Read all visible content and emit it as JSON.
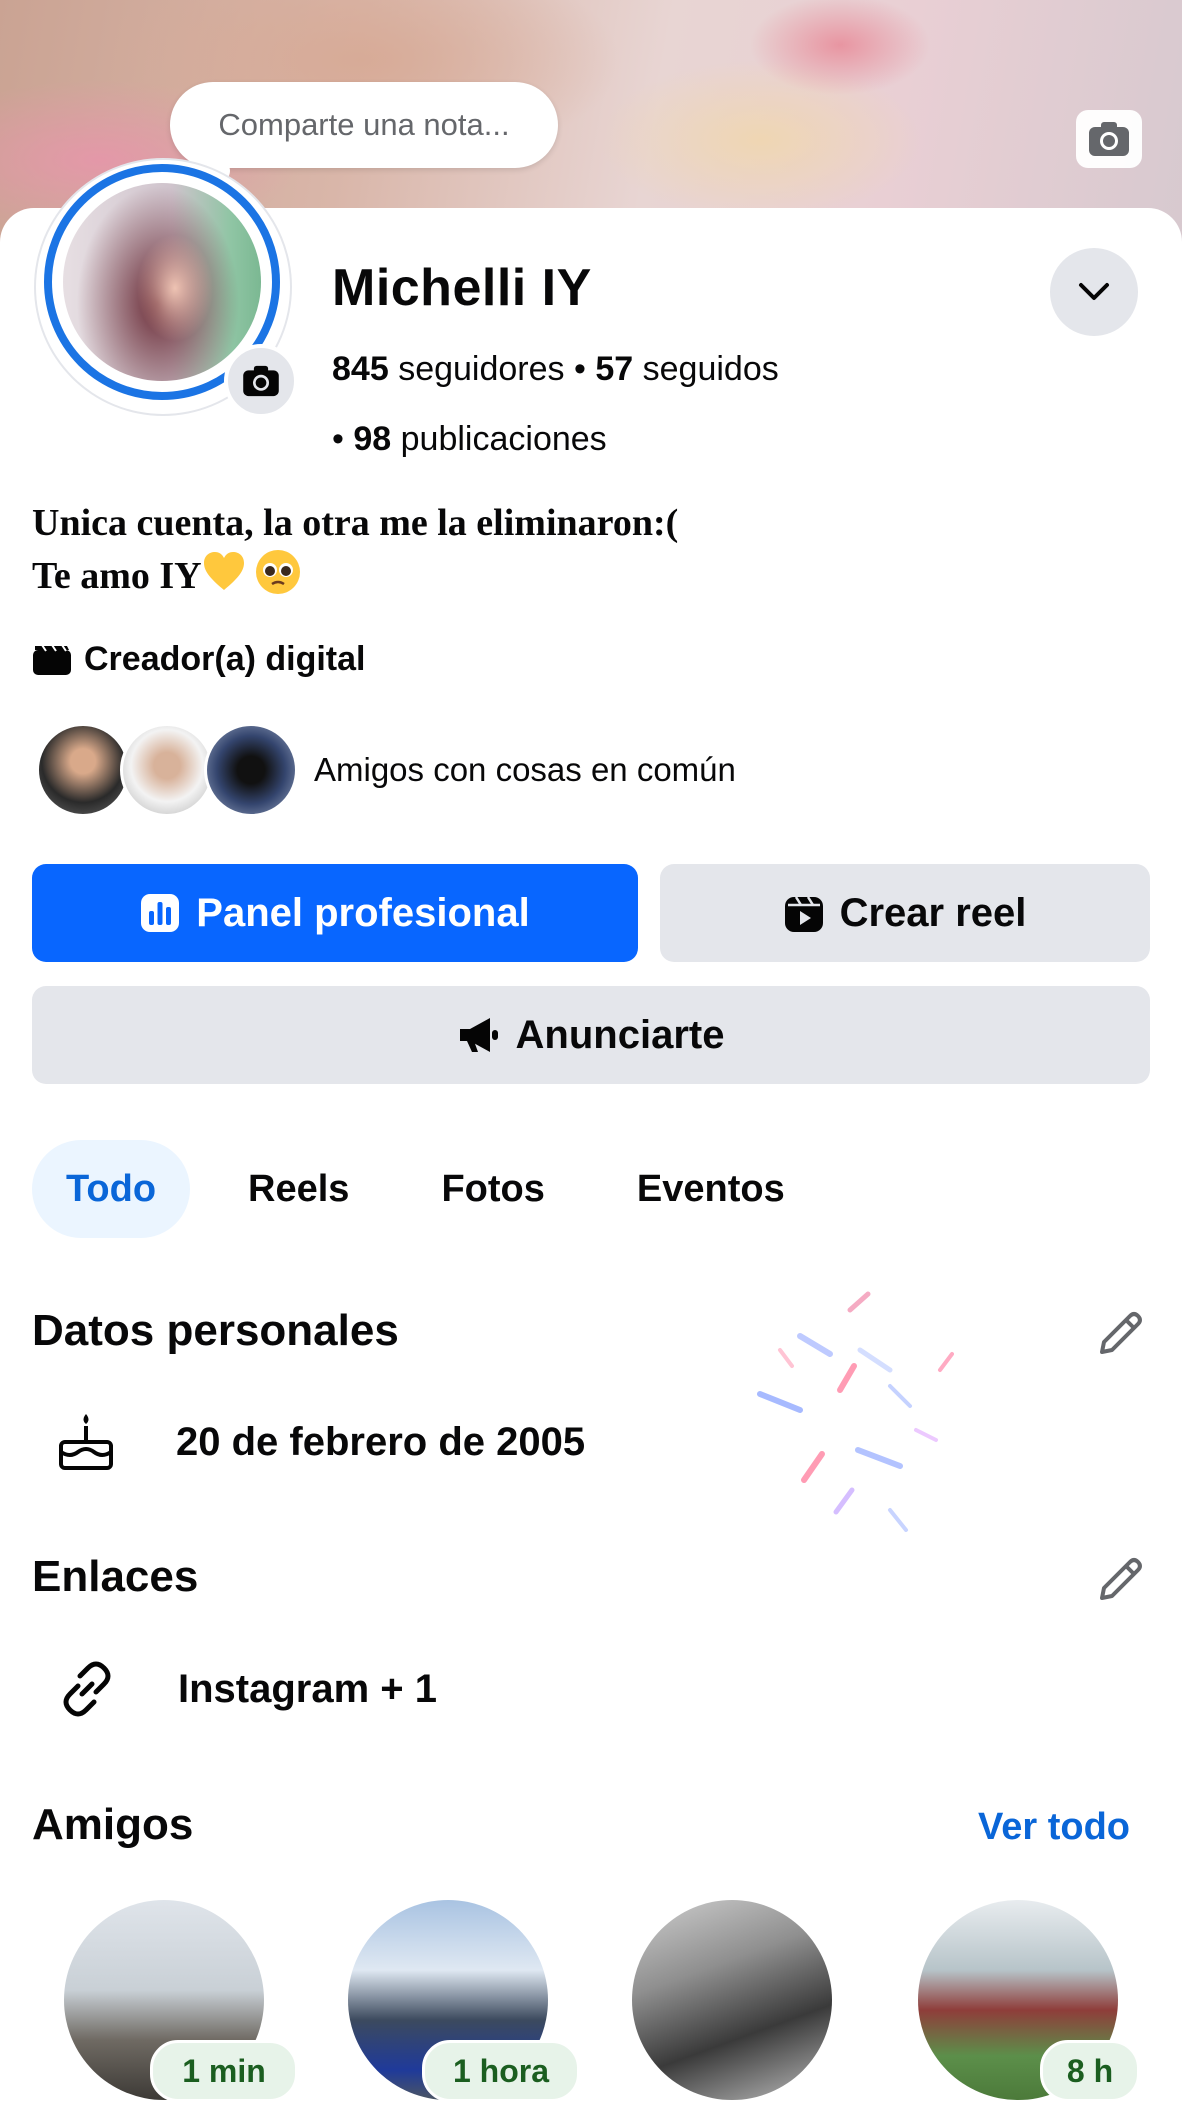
{
  "cover": {
    "note_placeholder": "Comparte una nota..."
  },
  "profile": {
    "name": "Michelli IY",
    "followers_count": "845",
    "followers_label": "seguidores",
    "following_count": "57",
    "following_label": "seguidos",
    "posts_count": "98",
    "posts_label": "publicaciones"
  },
  "bio": {
    "line1": "Unica cuenta, la otra me la eliminaron:(",
    "line2": "Te amo IY"
  },
  "category": "Creador(a) digital",
  "mutual": {
    "label": "Amigos con cosas en común"
  },
  "buttons": {
    "panel": "Panel profesional",
    "reel": "Crear reel",
    "ads": "Anunciarte"
  },
  "tabs": [
    "Todo",
    "Reels",
    "Fotos",
    "Eventos"
  ],
  "personal": {
    "title": "Datos personales",
    "birthday": "20 de febrero de 2005"
  },
  "links": {
    "title": "Enlaces",
    "value": "Instagram + 1"
  },
  "friends": {
    "title": "Amigos",
    "see_all": "Ver todo",
    "items": [
      {
        "badge": "1 min"
      },
      {
        "badge": "1 hora"
      },
      {
        "badge": ""
      },
      {
        "badge": "8 h"
      }
    ]
  },
  "colors": {
    "primary": "#0866ff",
    "link": "#0a66d8",
    "button_gray": "#e4e6eb",
    "tab_active_bg": "#ebf5ff"
  },
  "icons": [
    "camera-icon",
    "chevron-down-icon",
    "clapperboard-icon",
    "chart-icon",
    "reel-icon",
    "megaphone-icon",
    "pencil-icon",
    "cake-icon",
    "link-icon"
  ]
}
